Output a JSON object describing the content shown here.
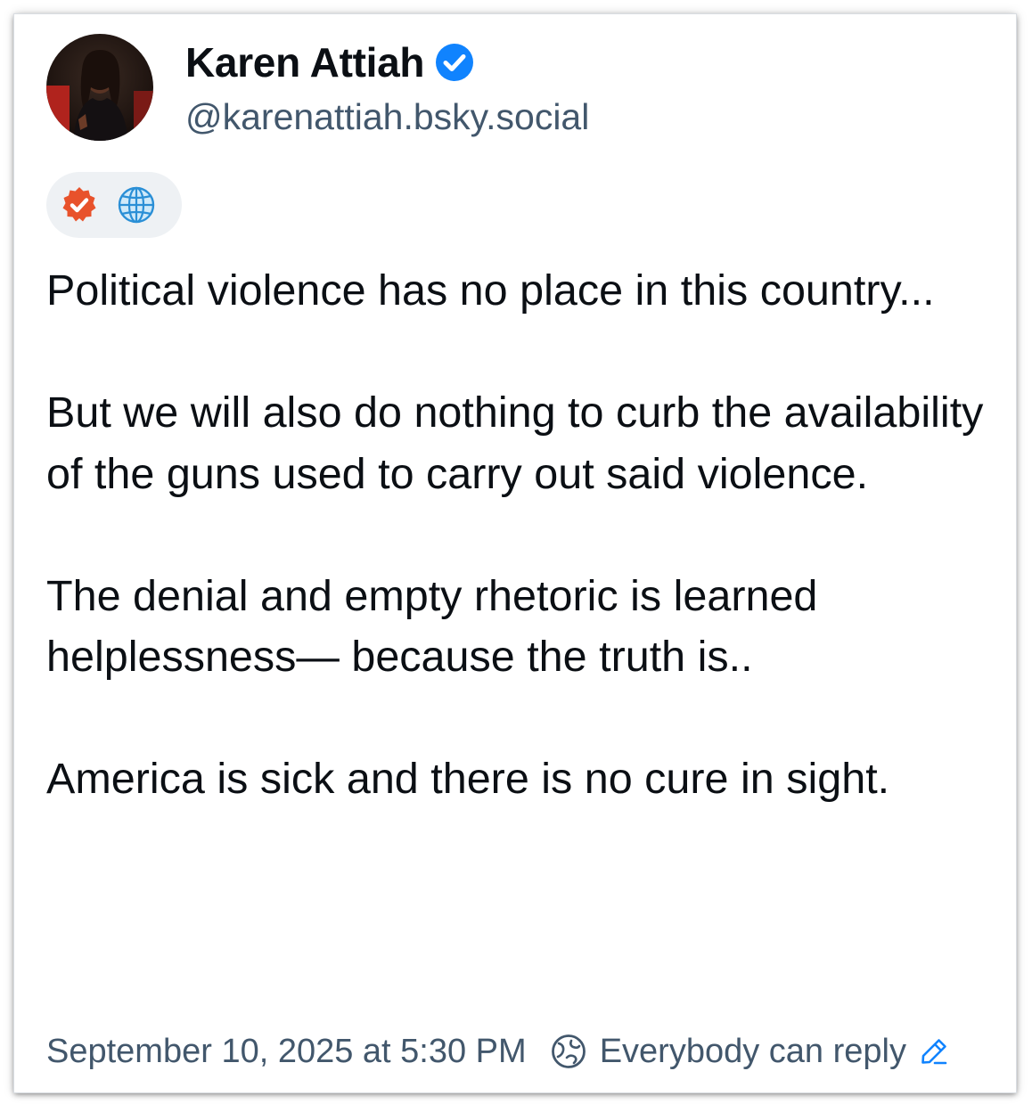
{
  "author": {
    "display_name": "Karen Attiah",
    "handle": "@karenattiah.bsky.social",
    "verified": true,
    "avatar_icon": "profile-photo",
    "verified_icon": "verified-badge-icon"
  },
  "labels": {
    "icons": [
      "checkmark-label-icon",
      "globe-icon"
    ]
  },
  "post": {
    "paragraphs": [
      "Political violence has no place in this country...",
      "But we will also do nothing to curb the availability of the guns used to carry out said violence.",
      "The denial and empty rhetoric is learned helplessness— because the truth is..",
      "America is sick and there is no cure in sight."
    ]
  },
  "footer": {
    "timestamp": "September 10, 2025 at 5:30 PM",
    "reply_setting": "Everybody can reply",
    "reply_icon": "globe-reply-icon",
    "edit_icon": "pencil-icon"
  },
  "colors": {
    "text": "#0b0f14",
    "secondary_text": "#42576c",
    "verified_blue": "#1083fe",
    "label_orange": "#e8522b",
    "pill_bg": "#eef1f4"
  }
}
